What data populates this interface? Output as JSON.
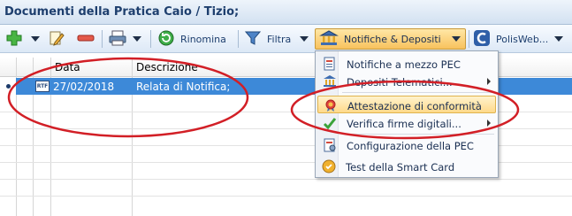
{
  "window": {
    "title": "Documenti della Pratica Caio / Tizio;"
  },
  "toolbar": {
    "rinomina_label": "Rinomina",
    "filtra_label": "Filtra",
    "notifiche_label": "Notifiche & Depositi",
    "polisweb_label": "PolisWeb..."
  },
  "grid": {
    "columns": [
      "Data",
      "Descrizione"
    ],
    "rows": [
      {
        "badge": "RTF",
        "data": "27/02/2018",
        "descrizione": "Relata di Notifica;"
      }
    ]
  },
  "menu": {
    "items": [
      {
        "label": "Notifiche a mezzo PEC",
        "icon": "pec-document-icon",
        "submenu": false
      },
      {
        "label": "Depositi Telematici...",
        "icon": "bank-building-icon",
        "submenu": true
      },
      {
        "label": "Attestazione di conformità",
        "icon": "seal-badge-icon",
        "submenu": false,
        "highlighted": true
      },
      {
        "label": "Verifica firme digitali...",
        "icon": "checkmark-icon",
        "submenu": true
      },
      {
        "label": "Configurazione della PEC",
        "icon": "pec-settings-icon",
        "submenu": false
      },
      {
        "label": "Test della Smart Card",
        "icon": "smart-card-icon",
        "submenu": false
      }
    ]
  },
  "colors": {
    "accent": "#3d89d8",
    "annotation": "#d21f26",
    "highlight": "#ffd98a"
  }
}
